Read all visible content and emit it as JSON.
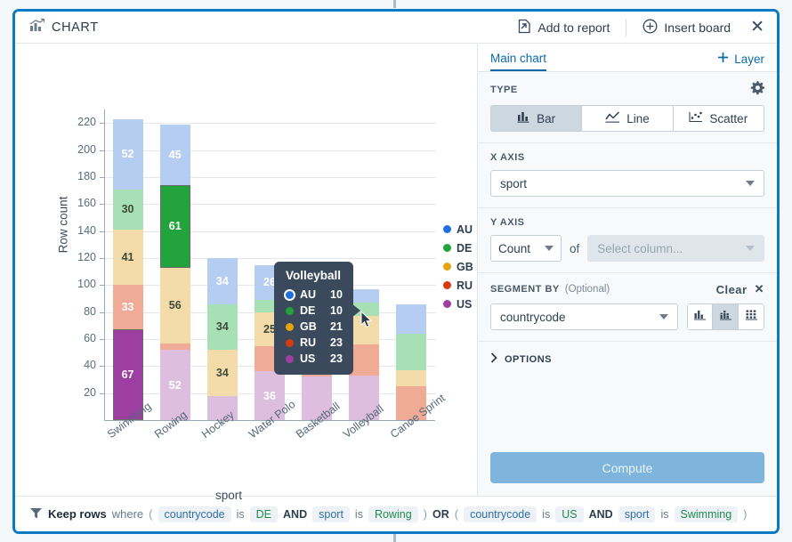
{
  "header": {
    "title": "CHART",
    "icon": "chart-bar-icon",
    "add_to_report": "Add to report",
    "add_to_report_icon": "export-report-icon",
    "insert_board": "Insert board",
    "insert_board_icon": "plus-circle-icon",
    "close_icon": "close-icon"
  },
  "panel": {
    "tab": "Main chart",
    "add_layer": "Layer",
    "add_layer_icon": "plus-icon",
    "type_label": "TYPE",
    "settings_icon": "gear-icon",
    "types": [
      {
        "label": "Bar",
        "icon": "bar-chart-icon",
        "active": true
      },
      {
        "label": "Line",
        "icon": "line-chart-icon",
        "active": false
      },
      {
        "label": "Scatter",
        "icon": "scatter-chart-icon",
        "active": false
      }
    ],
    "x_axis_label": "X AXIS",
    "x_axis_value": "sport",
    "y_axis_label": "Y AXIS",
    "y_agg_value": "Count",
    "y_of": "of",
    "y_column_placeholder": "Select column...",
    "segment_label": "SEGMENT BY",
    "segment_optional": "(Optional)",
    "segment_clear": "Clear",
    "segment_clear_icon": "close-icon",
    "segment_value": "countrycode",
    "segment_modes": [
      {
        "icon": "grouped-bars-icon",
        "active": false
      },
      {
        "icon": "stacked-bars-icon",
        "active": true
      },
      {
        "icon": "small-multiples-icon",
        "active": false
      }
    ],
    "options_label": "OPTIONS",
    "options_icon": "chevron-right-icon",
    "compute_label": "Compute"
  },
  "filter": {
    "icon": "filter-icon",
    "keep": "Keep rows",
    "where": "where",
    "open_paren": "(",
    "close_paren": ")",
    "or": "OR",
    "and": "AND",
    "is": "is",
    "clause1": {
      "field": "countrycode",
      "value": "DE",
      "field2": "sport",
      "value2": "Rowing"
    },
    "clause2": {
      "field": "countrycode",
      "value": "US",
      "field2": "sport",
      "value2": "Swimming"
    }
  },
  "tooltip": {
    "title": "Volleyball",
    "rows": [
      {
        "key": "AU",
        "value": "10",
        "color": "#1f6fe0",
        "selected": true
      },
      {
        "key": "DE",
        "value": "10",
        "color": "#23a33c",
        "selected": false
      },
      {
        "key": "GB",
        "value": "21",
        "color": "#e5a508",
        "selected": false
      },
      {
        "key": "RU",
        "value": "23",
        "color": "#d83a10",
        "selected": false
      },
      {
        "key": "US",
        "value": "23",
        "color": "#9c3fa0",
        "selected": false
      }
    ]
  },
  "chart_data": {
    "type": "bar",
    "stacked": true,
    "title": "",
    "xlabel": "sport",
    "ylabel": "Row count",
    "ylim": [
      0,
      230
    ],
    "yticks": [
      20,
      40,
      60,
      80,
      100,
      120,
      140,
      160,
      180,
      200,
      220
    ],
    "grid": true,
    "legend_position": "right",
    "categories": [
      "Swimming",
      "Rowing",
      "Hockey",
      "Water Polo",
      "Basketball",
      "Volleyball",
      "Canoe Sprint"
    ],
    "series": [
      {
        "name": "US",
        "color": "#9c3fa0",
        "fill": "#b063b6",
        "dim": "#ddbedf",
        "values": [
          67,
          52,
          18,
          36,
          32,
          33,
          0
        ]
      },
      {
        "name": "RU",
        "color": "#d83a10",
        "fill": "#ef9b85",
        "dim": "#f0ab96",
        "values": [
          33,
          5,
          0,
          19,
          22,
          23,
          25
        ]
      },
      {
        "name": "GB",
        "color": "#e5a508",
        "fill": "#f0d493",
        "dim": "#f3dcaa",
        "values": [
          41,
          56,
          34,
          25,
          22,
          21,
          12
        ]
      },
      {
        "name": "DE",
        "color": "#23a33c",
        "fill": "#9edcab",
        "dim": "#a8e0b5",
        "values": [
          30,
          61,
          34,
          9,
          10,
          10,
          27
        ]
      },
      {
        "name": "AU",
        "color": "#1f6fe0",
        "fill": "#aac4ef",
        "dim": "#b6cdf2",
        "values": [
          52,
          45,
          34,
          26,
          18,
          10,
          22
        ]
      }
    ],
    "highlighted": [
      {
        "category": "Swimming",
        "series": "US",
        "value": 67
      },
      {
        "category": "Rowing",
        "series": "DE",
        "value": 61
      }
    ],
    "bar_labels": {
      "Swimming": {
        "US": "67",
        "RU": "33",
        "GB": "41",
        "DE": "30",
        "AU": "52"
      },
      "Rowing": {
        "US": "52",
        "GB": "56",
        "DE": "61",
        "AU": "45"
      },
      "Hockey": {
        "GB": "34",
        "DE": "34",
        "AU": "34"
      },
      "Water Polo": {
        "US": "36",
        "GB": "25",
        "AU": "26"
      }
    }
  }
}
